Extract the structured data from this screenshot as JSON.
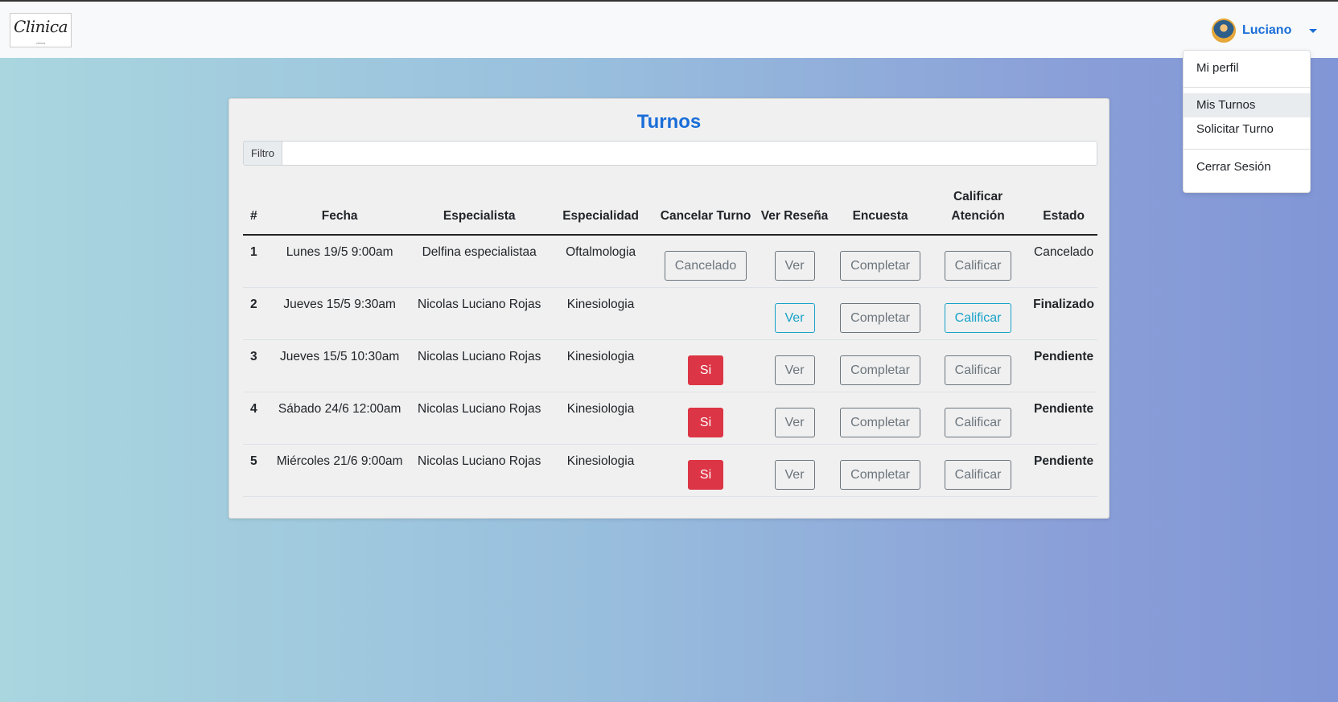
{
  "brand": {
    "logo_text": "Clinica",
    "logo_subtext": "clinica"
  },
  "user": {
    "name": "Luciano"
  },
  "menu": {
    "items": [
      {
        "label": "Mi perfil"
      },
      {
        "label": "Mis Turnos"
      },
      {
        "label": "Solicitar Turno"
      },
      {
        "label": "Cerrar Sesión"
      }
    ]
  },
  "page": {
    "title": "Turnos"
  },
  "filter": {
    "label": "Filtro",
    "value": "",
    "placeholder": ""
  },
  "table": {
    "headers": {
      "num": "#",
      "fecha": "Fecha",
      "especialista": "Especialista",
      "especialidad": "Especialidad",
      "cancelar": "Cancelar Turno",
      "resena": "Ver Reseña",
      "encuesta": "Encuesta",
      "calificar": "Calificar Atención",
      "estado": "Estado"
    },
    "rows": [
      {
        "num": "1",
        "fecha": "Lunes 19/5 9:00am",
        "especialista": "Delfina especialistaa",
        "especialidad": "Oftalmologia",
        "cancelar": "Cancelado",
        "resena": "Ver",
        "encuesta": "Completar",
        "calificar": "Calificar",
        "estado": "Cancelado"
      },
      {
        "num": "2",
        "fecha": "Jueves 15/5 9:30am",
        "especialista": "Nicolas Luciano Rojas",
        "especialidad": "Kinesiologia",
        "cancelar": "",
        "resena": "Ver",
        "encuesta": "Completar",
        "calificar": "Calificar",
        "estado": "Finalizado"
      },
      {
        "num": "3",
        "fecha": "Jueves 15/5 10:30am",
        "especialista": "Nicolas Luciano Rojas",
        "especialidad": "Kinesiologia",
        "cancelar": "Si",
        "resena": "Ver",
        "encuesta": "Completar",
        "calificar": "Calificar",
        "estado": "Pendiente"
      },
      {
        "num": "4",
        "fecha": "Sábado 24/6 12:00am",
        "especialista": "Nicolas Luciano Rojas",
        "especialidad": "Kinesiologia",
        "cancelar": "Si",
        "resena": "Ver",
        "encuesta": "Completar",
        "calificar": "Calificar",
        "estado": "Pendiente"
      },
      {
        "num": "5",
        "fecha": "Miércoles 21/6 9:00am",
        "especialista": "Nicolas Luciano Rojas",
        "especialidad": "Kinesiologia",
        "cancelar": "Si",
        "resena": "Ver",
        "encuesta": "Completar",
        "calificar": "Calificar",
        "estado": "Pendiente"
      }
    ]
  },
  "colors": {
    "accent": "#1a6ed8",
    "info": "#17a2c8",
    "danger": "#dc3545",
    "secondary": "#6c757d"
  },
  "icons": {
    "avatar": "user-avatar",
    "caret": "caret-down-icon"
  }
}
